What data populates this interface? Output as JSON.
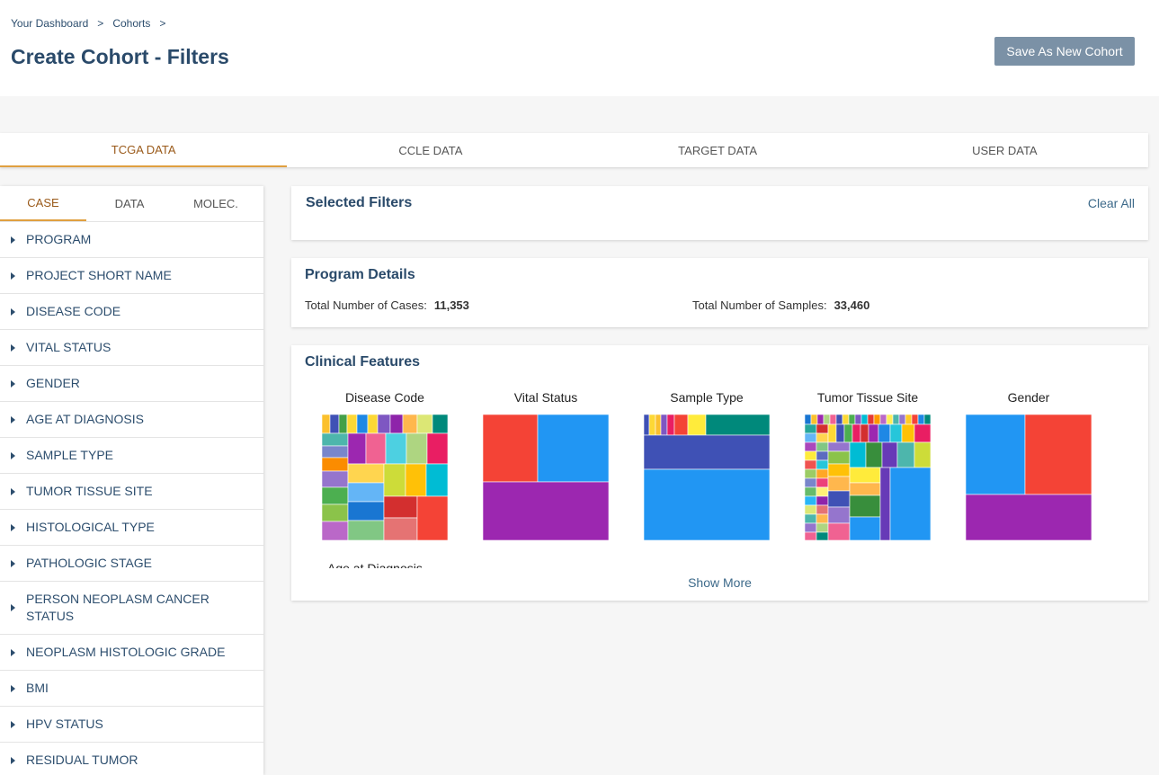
{
  "breadcrumb": {
    "items": [
      "Your Dashboard",
      "Cohorts"
    ],
    "separator": ">"
  },
  "header": {
    "title": "Create Cohort - Filters",
    "save_label": "Save As New Cohort"
  },
  "data_tabs": [
    "TCGA DATA",
    "CCLE DATA",
    "TARGET DATA",
    "USER DATA"
  ],
  "sidebar": {
    "tabs": [
      "CASE",
      "DATA",
      "MOLEC."
    ],
    "filters": [
      "PROGRAM",
      "PROJECT SHORT NAME",
      "DISEASE CODE",
      "VITAL STATUS",
      "GENDER",
      "AGE AT DIAGNOSIS",
      "SAMPLE TYPE",
      "TUMOR TISSUE SITE",
      "HISTOLOGICAL TYPE",
      "PATHOLOGIC STAGE",
      "PERSON NEOPLASM CANCER STATUS",
      "NEOPLASM HISTOLOGIC GRADE",
      "BMI",
      "HPV STATUS",
      "RESIDUAL TUMOR"
    ]
  },
  "selected_filters": {
    "title": "Selected Filters",
    "clear_label": "Clear All"
  },
  "program_details": {
    "title": "Program Details",
    "cases_label": "Total Number of Cases:",
    "cases_value": "11,353",
    "samples_label": "Total Number of Samples:",
    "samples_value": "33,460"
  },
  "clinical_features": {
    "title": "Clinical Features",
    "charts": [
      "Disease Code",
      "Vital Status",
      "Sample Type",
      "Tumor Tissue Site",
      "Gender"
    ],
    "next_chart_label": "Age at Diagnosis",
    "show_more": "Show More"
  }
}
